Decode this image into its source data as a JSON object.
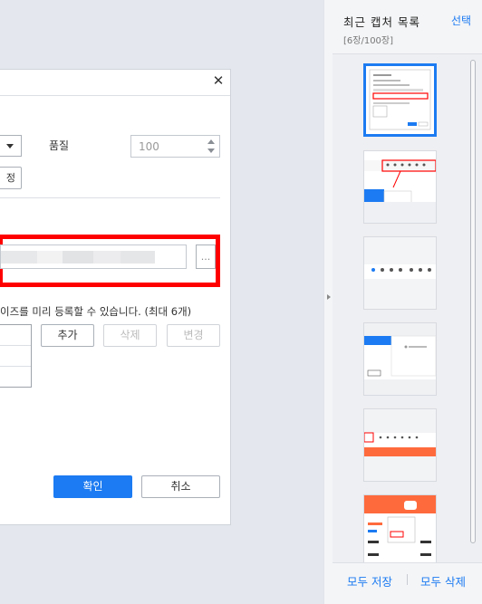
{
  "dialog": {
    "close_glyph": "✕",
    "quality_label": "품질",
    "quality_value": "100",
    "partial_button_label": "정",
    "browse_label": "...",
    "size_description": "이즈를 미리 등록할 수 있습니다. (최대 6개)",
    "add_label": "추가",
    "delete_label": "삭제",
    "change_label": "변경",
    "ok_label": "확인",
    "cancel_label": "취소",
    "highlight_color": "#ff0000",
    "accent_color": "#1c7bf2"
  },
  "panel": {
    "title": "최근 캡처 목록",
    "count": "[6장/100장]",
    "select_label": "선택",
    "save_all_label": "모두 저장",
    "delete_all_label": "모두 삭제",
    "thumbnails": [
      {
        "selected": true
      },
      {
        "selected": false
      },
      {
        "selected": false
      },
      {
        "selected": false
      },
      {
        "selected": false
      },
      {
        "selected": false
      }
    ]
  }
}
